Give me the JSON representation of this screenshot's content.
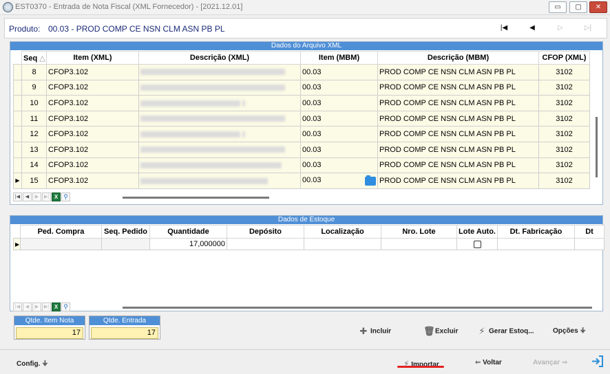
{
  "window": {
    "title": "EST0370 - Entrada de Nota Fiscal (XML Fornecedor) - [2021.12.01]",
    "buttons": {
      "minimize": "▭",
      "restore": "▢",
      "close": "✕"
    }
  },
  "product": {
    "label": "Produto:",
    "value": "00.03 - PROD COMP CE NSN CLM ASN PB PL"
  },
  "nav_icons": [
    "first-record-icon",
    "previous-record-icon",
    "next-record-icon",
    "last-record-icon"
  ],
  "xml_panel": {
    "title": "Dados do Arquivo XML",
    "columns": [
      "Seq",
      "Item (XML)",
      "Descrição (XML)",
      "Item (MBM)",
      "Descrição (MBM)",
      "CFOP (XML)"
    ],
    "sort_glyph": "△",
    "current_row_marker": "▶",
    "rows": [
      {
        "seq": "8",
        "item_xml": "CFOP3.102",
        "item_mbm": "00.03",
        "desc_mbm": "PROD COMP CE NSN CLM ASN PB PL",
        "cfop": "3102"
      },
      {
        "seq": "9",
        "item_xml": "CFOP3.102",
        "item_mbm": "00.03",
        "desc_mbm": "PROD COMP CE NSN CLM ASN PB PL",
        "cfop": "3102"
      },
      {
        "seq": "10",
        "item_xml": "CFOP3.102",
        "item_mbm": "00.03",
        "desc_mbm": "PROD COMP CE NSN CLM ASN PB PL",
        "cfop": "3102"
      },
      {
        "seq": "11",
        "item_xml": "CFOP3.102",
        "item_mbm": "00.03",
        "desc_mbm": "PROD COMP CE NSN CLM ASN PB PL",
        "cfop": "3102"
      },
      {
        "seq": "12",
        "item_xml": "CFOP3.102",
        "item_mbm": "00.03",
        "desc_mbm": "PROD COMP CE NSN CLM ASN PB PL",
        "cfop": "3102"
      },
      {
        "seq": "13",
        "item_xml": "CFOP3.102",
        "item_mbm": "00.03",
        "desc_mbm": "PROD COMP CE NSN CLM ASN PB PL",
        "cfop": "3102"
      },
      {
        "seq": "14",
        "item_xml": "CFOP3.102",
        "item_mbm": "00.03",
        "desc_mbm": "PROD COMP CE NSN CLM ASN PB PL",
        "cfop": "3102"
      },
      {
        "seq": "15",
        "item_xml": "CFOP3.102",
        "item_mbm": "00.03",
        "desc_mbm": "PROD COMP CE NSN CLM ASN PB PL",
        "cfop": "3102"
      }
    ]
  },
  "stock_panel": {
    "title": "Dados de Estoque",
    "columns": [
      "Ped. Compra",
      "Seq. Pedido",
      "Quantidade",
      "Depósito",
      "Localização",
      "Nro. Lote",
      "Lote Auto.",
      "Dt. Fabricação",
      "Dt"
    ],
    "row": {
      "marker": "▶",
      "quantidade": "17,000000"
    }
  },
  "totals": {
    "item_nota_label": "Qtde. Item Nota",
    "item_nota_value": "17",
    "entrada_label": "Qtde. Entrada",
    "entrada_value": "17"
  },
  "actions": {
    "incluir": "Incluir",
    "excluir": "Excluir",
    "gerar_estoque": "Gerar Estoq...",
    "opcoes": "Opções"
  },
  "footer": {
    "config": "Config.",
    "importar": "Importar",
    "voltar": "Voltar",
    "avancar": "Avançar"
  },
  "colors": {
    "accent": "#4f8fd6",
    "grid_cell": "#fbfbe6",
    "total_field": "#fff2b3",
    "highlight_mark": "#e32222",
    "product_text": "#1b2a78"
  }
}
